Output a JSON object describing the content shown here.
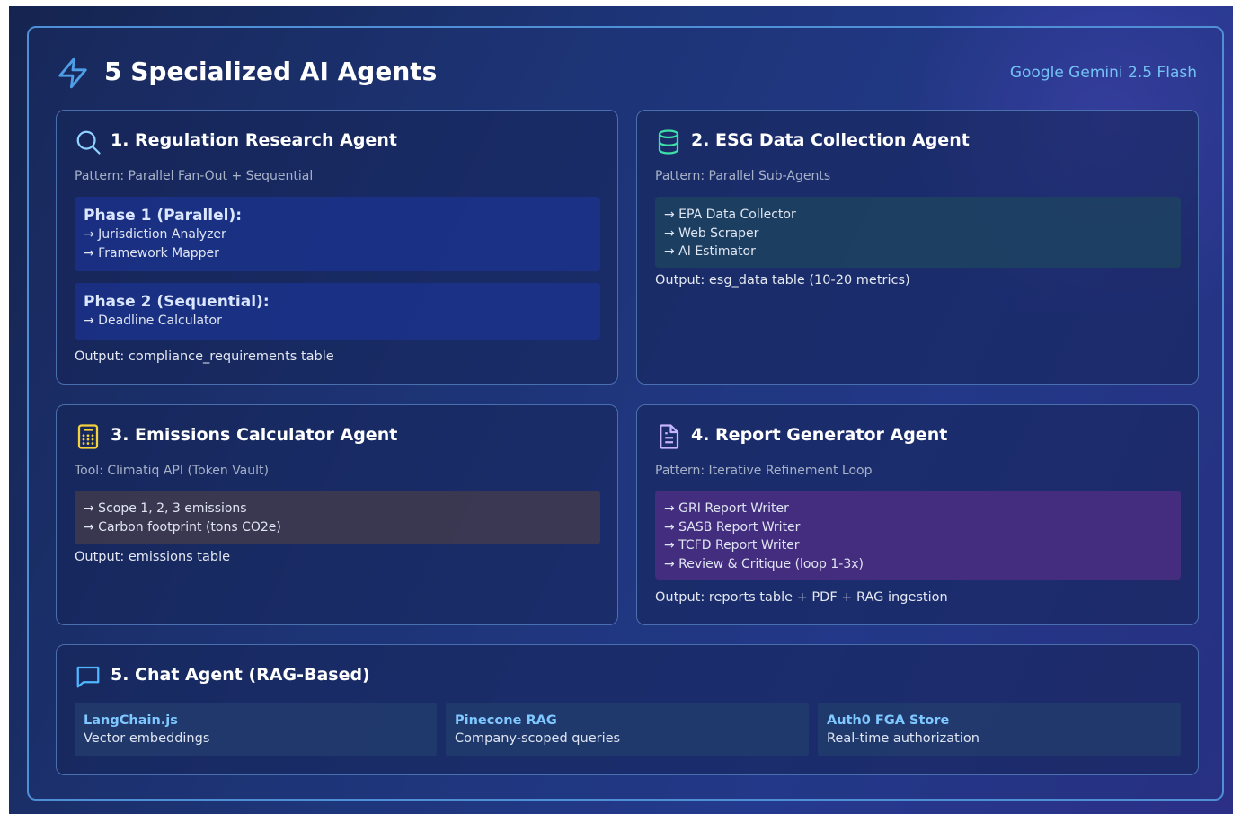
{
  "header": {
    "title": "5 Specialized AI Agents",
    "model": "Google Gemini 2.5 Flash",
    "icon": "lightning-icon"
  },
  "colors": {
    "accent_blue": "#4f8fd6",
    "model_text": "#74c2f5",
    "search_icon": "#8fd1ff",
    "database_icon": "#3ee0a8",
    "calculator_icon": "#f4d23c",
    "document_icon": "#c6b4ff",
    "chat_icon": "#4fb6ff",
    "chat_item_title": "#7fc7ff"
  },
  "agents": {
    "regulation": {
      "icon": "search-icon",
      "title": "1. Regulation Research Agent",
      "subtitle": "Pattern: Parallel Fan-Out + Sequential",
      "phase1_title": "Phase 1 (Parallel):",
      "phase1_items": [
        "→ Jurisdiction Analyzer",
        "→ Framework Mapper"
      ],
      "phase2_title": "Phase 2 (Sequential):",
      "phase2_items": [
        "→ Deadline Calculator"
      ],
      "output": "Output: compliance_requirements table"
    },
    "esg": {
      "icon": "database-icon",
      "title": "2. ESG Data Collection Agent",
      "subtitle": "Pattern: Parallel Sub-Agents",
      "items": [
        "→ EPA Data Collector",
        "→ Web Scraper",
        "→ AI Estimator"
      ],
      "output": "Output: esg_data table (10-20 metrics)"
    },
    "emissions": {
      "icon": "calculator-icon",
      "title": "3. Emissions Calculator Agent",
      "subtitle": "Tool: Climatiq API (Token Vault)",
      "items": [
        "→ Scope 1, 2, 3 emissions",
        "→ Carbon footprint (tons CO2e)"
      ],
      "output": "Output: emissions table"
    },
    "report": {
      "icon": "document-icon",
      "title": "4. Report Generator Agent",
      "subtitle": "Pattern: Iterative Refinement Loop",
      "items": [
        "→ GRI Report Writer",
        "→ SASB Report Writer",
        "→ TCFD Report Writer",
        "→ Review & Critique (loop 1-3x)"
      ],
      "output": "Output: reports table + PDF + RAG ingestion"
    },
    "chat": {
      "icon": "chat-icon",
      "title": "5. Chat Agent (RAG-Based)",
      "components": [
        {
          "title": "LangChain.js",
          "desc": "Vector embeddings"
        },
        {
          "title": "Pinecone RAG",
          "desc": "Company-scoped queries"
        },
        {
          "title": "Auth0 FGA Store",
          "desc": "Real-time authorization"
        }
      ]
    }
  }
}
